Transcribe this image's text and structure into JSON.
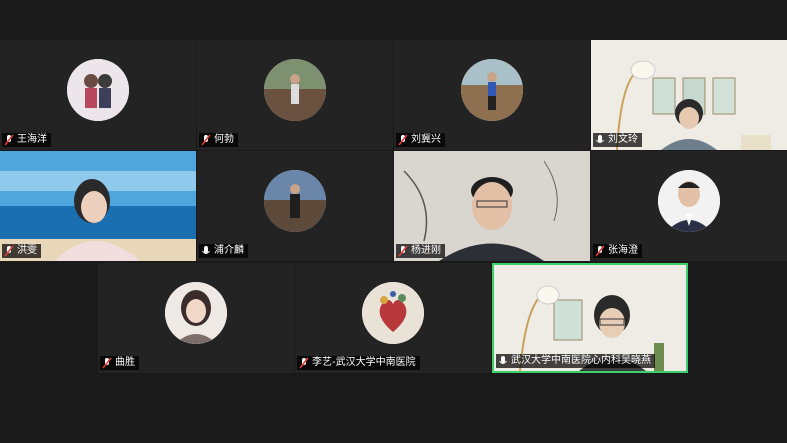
{
  "participants": [
    {
      "name": "王海洋",
      "mic": "muted",
      "view": "avatar"
    },
    {
      "name": "何勃",
      "mic": "muted",
      "view": "avatar"
    },
    {
      "name": "刘冀兴",
      "mic": "muted",
      "view": "avatar"
    },
    {
      "name": "刘文玲",
      "mic": "on",
      "view": "video"
    },
    {
      "name": "洪雯",
      "mic": "muted",
      "view": "video"
    },
    {
      "name": "浦介麟",
      "mic": "on",
      "view": "avatar"
    },
    {
      "name": "杨进刚",
      "mic": "muted",
      "view": "video"
    },
    {
      "name": "张海澄",
      "mic": "muted",
      "view": "avatar"
    },
    {
      "name": "曲胜",
      "mic": "muted",
      "view": "avatar"
    },
    {
      "name": "李艺-武汉大学中南医院",
      "mic": "muted",
      "view": "avatar"
    },
    {
      "name": "武汉大学中南医院心内科吴晓燕",
      "mic": "on",
      "view": "video",
      "active_speaker": true
    }
  ],
  "colors": {
    "active_border": "#3ccf6b",
    "background": "#1a1a1a",
    "tile": "#232323"
  }
}
